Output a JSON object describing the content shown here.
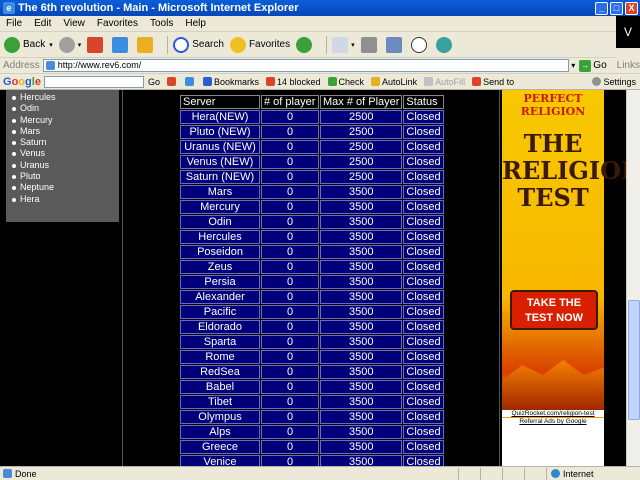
{
  "window": {
    "title": "The 6th revolution - Main - Microsoft Internet Explorer",
    "minimize": "_",
    "maximize": "□",
    "close": "X"
  },
  "menu": [
    "File",
    "Edit",
    "View",
    "Favorites",
    "Tools",
    "Help"
  ],
  "ie_logo": "V",
  "toolbar": {
    "back": "Back",
    "search": "Search",
    "favorites": "Favorites"
  },
  "address": {
    "label": "Address",
    "url": "http://www.rev6.com/",
    "go": "Go",
    "links": "Links"
  },
  "google_toolbar": {
    "go": "Go",
    "bookmarks": "Bookmarks",
    "blocked": "14 blocked",
    "check": "Check",
    "autolink": "AutoLink",
    "autofill": "AutoFill",
    "sendto": "Send to",
    "settings": "Settings"
  },
  "sidebar": {
    "items": [
      "Hercules",
      "Odin",
      "Mercury",
      "Mars",
      "Saturn",
      "Venus",
      "Uranus",
      "Pluto",
      "Neptune",
      "Hera"
    ]
  },
  "servers_table": {
    "headers": [
      "Server",
      "# of player",
      "Max # of Player",
      "Status"
    ],
    "rows": [
      [
        "Hera(NEW)",
        "0",
        "2500",
        "Closed"
      ],
      [
        "Pluto (NEW)",
        "0",
        "2500",
        "Closed"
      ],
      [
        "Uranus (NEW)",
        "0",
        "2500",
        "Closed"
      ],
      [
        "Venus (NEW)",
        "0",
        "2500",
        "Closed"
      ],
      [
        "Saturn (NEW)",
        "0",
        "2500",
        "Closed"
      ],
      [
        "Mars",
        "0",
        "3500",
        "Closed"
      ],
      [
        "Mercury",
        "0",
        "3500",
        "Closed"
      ],
      [
        "Odin",
        "0",
        "3500",
        "Closed"
      ],
      [
        "Hercules",
        "0",
        "3500",
        "Closed"
      ],
      [
        "Poseidon",
        "0",
        "3500",
        "Closed"
      ],
      [
        "Zeus",
        "0",
        "3500",
        "Closed"
      ],
      [
        "Persia",
        "0",
        "3500",
        "Closed"
      ],
      [
        "Alexander",
        "0",
        "3500",
        "Closed"
      ],
      [
        "Pacific",
        "0",
        "3500",
        "Closed"
      ],
      [
        "Eldorado",
        "0",
        "3500",
        "Closed"
      ],
      [
        "Sparta",
        "0",
        "3500",
        "Closed"
      ],
      [
        "Rome",
        "0",
        "3500",
        "Closed"
      ],
      [
        "RedSea",
        "0",
        "3500",
        "Closed"
      ],
      [
        "Babel",
        "0",
        "3500",
        "Closed"
      ],
      [
        "Tibet",
        "0",
        "3500",
        "Closed"
      ],
      [
        "Olympus",
        "0",
        "3500",
        "Closed"
      ],
      [
        "Alps",
        "0",
        "3500",
        "Closed"
      ],
      [
        "Greece",
        "0",
        "3500",
        "Closed"
      ],
      [
        "Venice",
        "0",
        "3500",
        "Closed"
      ]
    ]
  },
  "ad": {
    "brand": "PERFECT RELIGION",
    "title_line1": "THE",
    "title_line2": "RELIGION",
    "title_line3": "TEST",
    "cta_line1": "TAKE THE",
    "cta_line2": "TEST NOW",
    "url": "QuizRocket.com/religion-test",
    "ads_by": "Referral Ads by Google"
  },
  "status": {
    "text": "Done",
    "zone": "Internet"
  },
  "colors": {
    "table_cell": "#00007a",
    "title_bar": "#0a5fd8"
  }
}
